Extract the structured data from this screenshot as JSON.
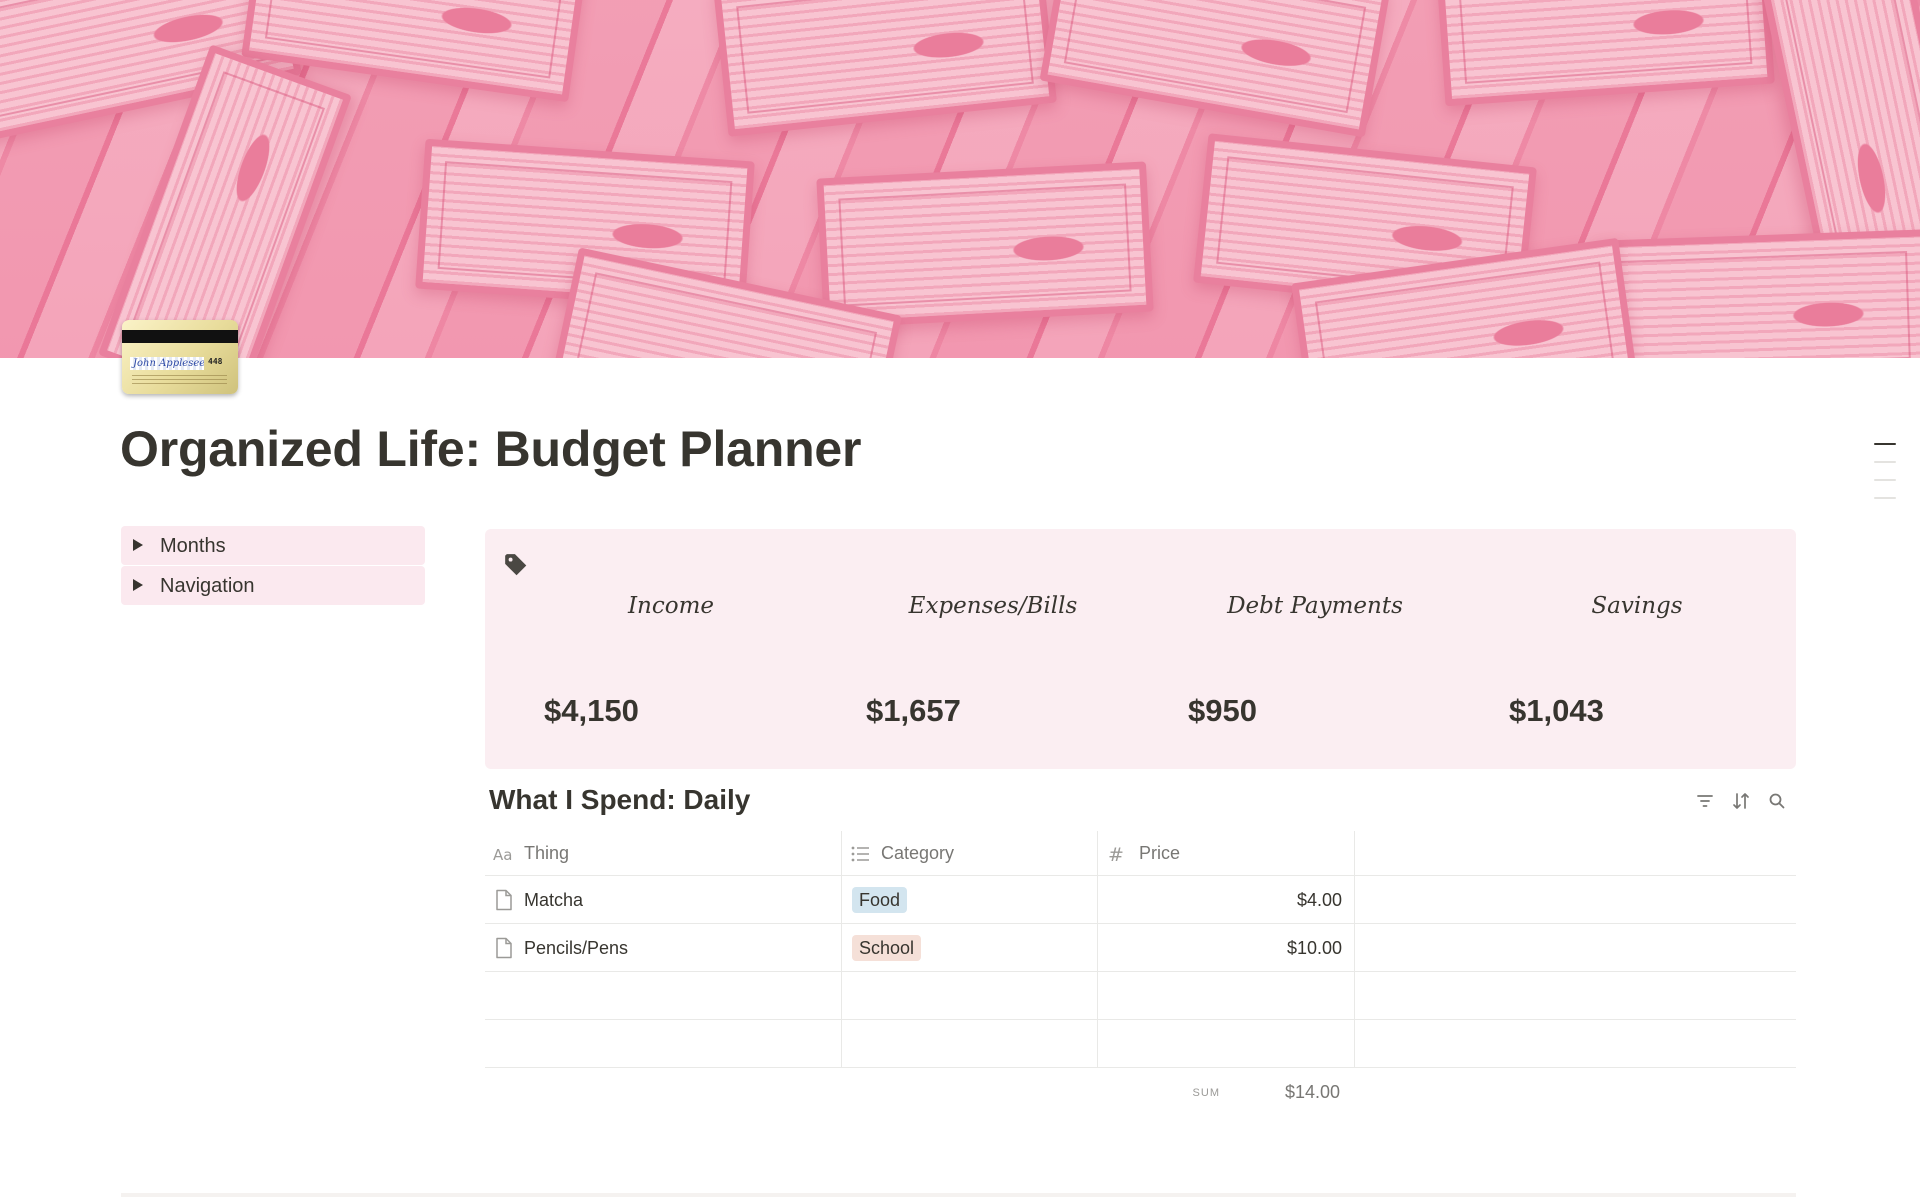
{
  "page": {
    "title": "Organized Life: Budget Planner",
    "icon": "credit-card-icon",
    "cover": "pink-dollar-bills-cover"
  },
  "card": {
    "signature": "John Appleseed",
    "cvv": "448"
  },
  "toggles": [
    {
      "label": "Months"
    },
    {
      "label": "Navigation"
    }
  ],
  "summary": {
    "icon": "tag-icon",
    "background": "#fbeef2",
    "stats": [
      {
        "label": "Income",
        "value": "$4,150"
      },
      {
        "label": "Expenses/Bills",
        "value": "$1,657"
      },
      {
        "label": "Debt Payments",
        "value": "$950"
      },
      {
        "label": "Savings",
        "value": "$1,043"
      }
    ]
  },
  "database": {
    "title": "What I Spend: Daily",
    "tools": [
      "filter-icon",
      "sort-icon",
      "search-icon"
    ],
    "columns": [
      {
        "label": "Thing",
        "icon": "title-property-icon"
      },
      {
        "label": "Category",
        "icon": "list-property-icon"
      },
      {
        "label": "Price",
        "icon": "number-property-icon"
      }
    ],
    "rows": [
      {
        "thing": "Matcha",
        "category": "Food",
        "category_color": "#d3e5ef",
        "price": "$4.00"
      },
      {
        "thing": "Pencils/Pens",
        "category": "School",
        "category_color": "#f5e0d8",
        "price": "$10.00"
      }
    ],
    "empty_rows": 2,
    "sum_label": "SUM",
    "sum_value": "$14.00"
  }
}
